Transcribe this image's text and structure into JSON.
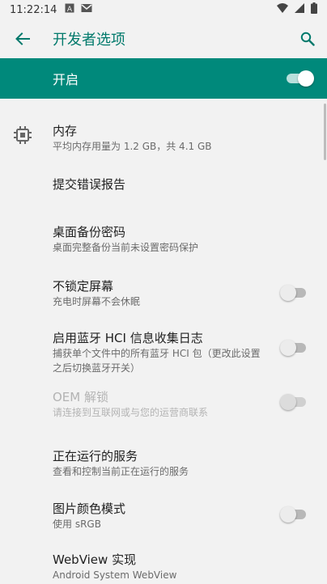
{
  "status_bar": {
    "time": "11:22:14"
  },
  "app_bar": {
    "title": "开发者选项"
  },
  "master": {
    "label": "开启",
    "enabled": true
  },
  "items": [
    {
      "title": "内存",
      "summary": "平均内存用量为 1.2 GB，共 4.1 GB"
    },
    {
      "title": "提交错误报告"
    },
    {
      "title": "桌面备份密码",
      "summary": "桌面完整备份当前未设置密码保护"
    },
    {
      "title": "不锁定屏幕",
      "summary": "充电时屏幕不会休眠",
      "checked": false
    },
    {
      "title": "启用蓝牙 HCI 信息收集日志",
      "summary": "捕获单个文件中的所有蓝牙 HCI 包（更改此设置之后切换蓝牙开关）",
      "summary_line1": "捕获单个文件中的所有蓝牙 HCI 包（更改此设置",
      "summary_line2": "之后切换蓝牙开关）",
      "checked": false
    },
    {
      "title": "OEM 解锁",
      "summary": "请连接到互联网或与您的运营商联系",
      "checked": false,
      "disabled": true
    },
    {
      "title": "正在运行的服务",
      "summary": "查看和控制当前正在运行的服务"
    },
    {
      "title": "图片颜色模式",
      "summary": "使用 sRGB",
      "checked": false
    },
    {
      "title": "WebView 实现",
      "summary": "Android System WebView"
    }
  ],
  "colors": {
    "accent": "#00897b",
    "title_text": "#00796b",
    "background": "#f2f2f2"
  },
  "icons": [
    "a-icon",
    "mail-icon",
    "wifi-icon",
    "battery-icon",
    "back-arrow-icon",
    "search-icon",
    "memory-chip-icon"
  ]
}
